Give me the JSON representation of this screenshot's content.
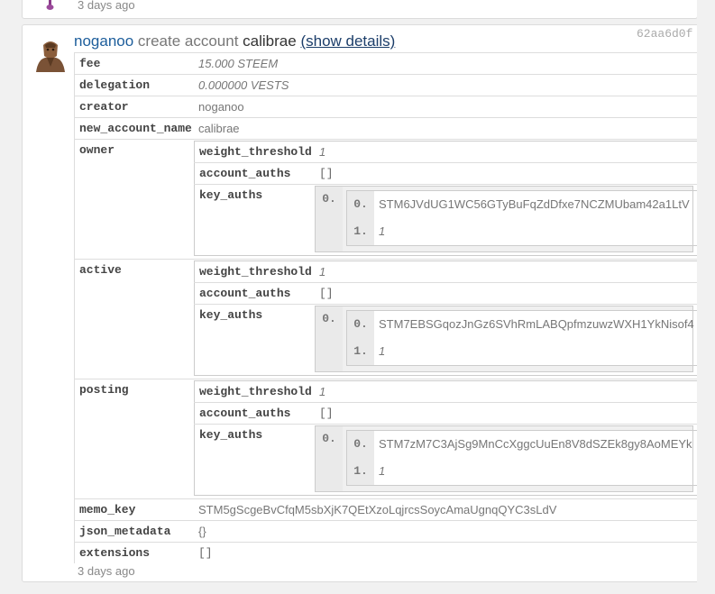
{
  "previous_op": {
    "timestamp": "3 days ago"
  },
  "op": {
    "hash": "62aa6d0f",
    "creator_link": "noganoo",
    "action": "create account",
    "new_account": "calibrae",
    "details_link": "(show details)",
    "timestamp": "3 days ago",
    "fields": {
      "fee": {
        "key": "fee",
        "value": "15.000 STEEM"
      },
      "delegation": {
        "key": "delegation",
        "value": "0.000000 VESTS"
      },
      "creator": {
        "key": "creator",
        "value": "noganoo"
      },
      "new_account_name": {
        "key": "new_account_name",
        "value": "calibrae"
      },
      "memo_key": {
        "key": "memo_key",
        "value": "STM5gScgeBvCfqM5sbXjK7QEtXzoLqjrcsSoycAmaUgnqQYC3sLdV"
      },
      "json_metadata": {
        "key": "json_metadata",
        "value": "{}"
      },
      "extensions": {
        "key": "extensions",
        "value": "[]"
      }
    },
    "authorities": {
      "owner": {
        "key": "owner",
        "weight_threshold_key": "weight_threshold",
        "weight_threshold": "1",
        "account_auths_key": "account_auths",
        "account_auths": "[]",
        "key_auths_key": "key_auths",
        "outer_index": "0.",
        "idx0": "0.",
        "pubkey": "STM6JVdUG1WC56GTyBuFqZdDfxe7NCZMUbam42a1LtV",
        "idx1": "1.",
        "weight": "1"
      },
      "active": {
        "key": "active",
        "weight_threshold_key": "weight_threshold",
        "weight_threshold": "1",
        "account_auths_key": "account_auths",
        "account_auths": "[]",
        "key_auths_key": "key_auths",
        "outer_index": "0.",
        "idx0": "0.",
        "pubkey": "STM7EBSGqozJnGz6SVhRmLABQpfmzuwzWXH1YkNisof4",
        "idx1": "1.",
        "weight": "1"
      },
      "posting": {
        "key": "posting",
        "weight_threshold_key": "weight_threshold",
        "weight_threshold": "1",
        "account_auths_key": "account_auths",
        "account_auths": "[]",
        "key_auths_key": "key_auths",
        "outer_index": "0.",
        "idx0": "0.",
        "pubkey": "STM7zM7C3AjSg9MnCcXggcUuEn8V8dSZEk8gy8AoMEYk",
        "idx1": "1.",
        "weight": "1"
      }
    }
  }
}
